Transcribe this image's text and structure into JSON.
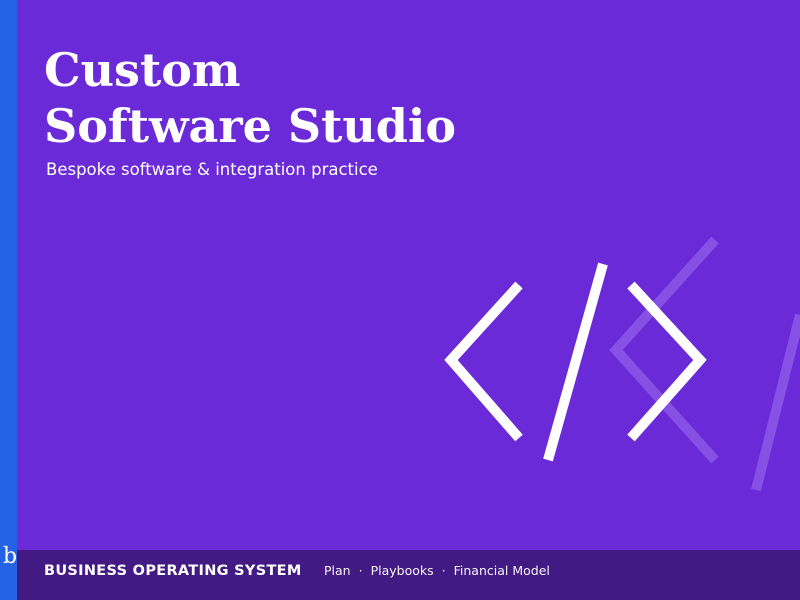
{
  "slide": {
    "title_line1": "Custom",
    "title_line2": "Software Studio",
    "subtitle": "Bespoke software & integration practice",
    "brand_glyph": "b",
    "icon": "code-brackets-icon"
  },
  "footer": {
    "title": "BUSINESS OPERATING SYSTEM",
    "nav_items": [
      "Plan",
      "Playbooks",
      "Financial Model"
    ],
    "separator": "·"
  },
  "colors": {
    "background": "#6b2ad8",
    "side_bar": "#2563e6",
    "footer_bar": "#431a83",
    "text": "#ffffff"
  }
}
